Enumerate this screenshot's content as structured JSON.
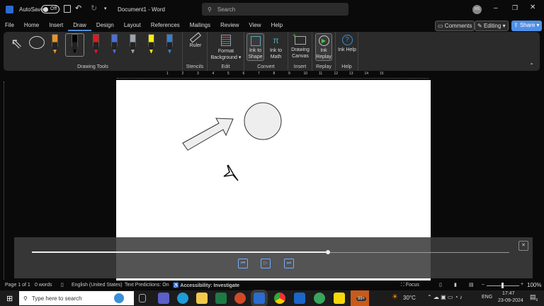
{
  "titlebar": {
    "autosave_label": "AutoSave",
    "autosave_state": "Off",
    "document_title": "Document1 - Word",
    "search_placeholder": "Search",
    "avatar_initials": "RS"
  },
  "tabs": [
    "File",
    "Home",
    "Insert",
    "Draw",
    "Design",
    "Layout",
    "References",
    "Mailings",
    "Review",
    "View",
    "Help"
  ],
  "actions": {
    "comments": "Comments",
    "editing": "Editing",
    "share": "Share"
  },
  "ribbon": {
    "groups": {
      "drawing_tools": "Drawing Tools",
      "stencils": "Stencils",
      "edit": "Edit",
      "convert": "Convert",
      "insert": "Insert",
      "replay": "Replay",
      "help": "Help"
    },
    "buttons": {
      "ruler": "Ruler",
      "format_background": "Format Background",
      "ink_to_shape": "Ink to Shape",
      "ink_to_math": "Ink to Math",
      "drawing_canvas": "Drawing Canvas",
      "ink_replay": "Ink Replay",
      "ink_help": "Ink Help"
    },
    "pen_colors": [
      "#e8922a",
      "#000000",
      "#e01a1a",
      "#4a6fd6",
      "#9aa4ad",
      "#ffef00",
      "#2f7fd8"
    ]
  },
  "ruler_numbers": [
    "1",
    "2",
    "3",
    "4",
    "5",
    "6",
    "7",
    "8",
    "9",
    "10",
    "11",
    "12",
    "13",
    "14",
    "15"
  ],
  "replay": {
    "progress": 0.62
  },
  "status": {
    "page": "Page 1 of 1",
    "words": "0 words",
    "language": "English (United States)",
    "predictions": "Text Predictions: On",
    "accessibility": "Accessibility: Investigate",
    "focus": "Focus",
    "zoom": "100%"
  },
  "taskbar": {
    "search_placeholder": "Type here to search",
    "weather": "30°C",
    "lang": "ENG",
    "time": "17:47",
    "date": "23-09-2024",
    "badge": "99+",
    "notif_count": "6"
  }
}
